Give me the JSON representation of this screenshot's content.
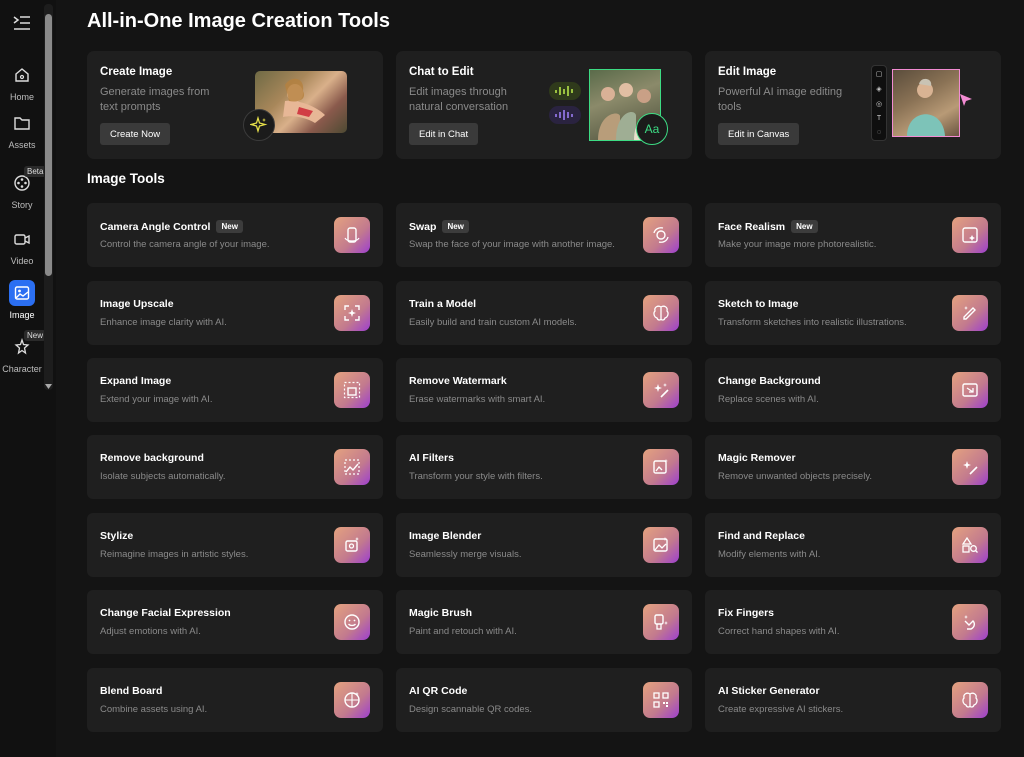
{
  "sidebar": {
    "items": [
      {
        "label": "Home"
      },
      {
        "label": "Assets"
      },
      {
        "label": "Story",
        "badge": "Beta"
      },
      {
        "label": "Video"
      },
      {
        "label": "Image"
      },
      {
        "label": "Character",
        "badge": "New"
      }
    ]
  },
  "page": {
    "title": "All-in-One Image Creation Tools",
    "section_title": "Image Tools"
  },
  "features": [
    {
      "title": "Create Image",
      "desc": "Generate images from text prompts",
      "button": "Create Now"
    },
    {
      "title": "Chat to Edit",
      "desc": "Edit images through natural conversation",
      "button": "Edit in Chat"
    },
    {
      "title": "Edit Image",
      "desc": "Powerful AI image editing tools",
      "button": "Edit in Canvas"
    }
  ],
  "feature_visual": {
    "aa_label": "Aa"
  },
  "tools": [
    {
      "title": "Camera Angle Control",
      "badge": "New",
      "desc": "Control the camera angle of your image."
    },
    {
      "title": "Swap",
      "badge": "New",
      "desc": "Swap the face of your image with another image."
    },
    {
      "title": "Face Realism",
      "badge": "New",
      "desc": "Make your image more photorealistic."
    },
    {
      "title": "Image Upscale",
      "desc": "Enhance image clarity with AI."
    },
    {
      "title": "Train a Model",
      "desc": "Easily build and train custom AI models."
    },
    {
      "title": "Sketch to Image",
      "desc": "Transform sketches into realistic illustrations."
    },
    {
      "title": "Expand Image",
      "desc": "Extend your image with AI."
    },
    {
      "title": "Remove Watermark",
      "desc": "Erase watermarks with smart AI."
    },
    {
      "title": "Change Background",
      "desc": "Replace scenes with AI."
    },
    {
      "title": "Remove background",
      "desc": "Isolate subjects automatically."
    },
    {
      "title": "AI Filters",
      "desc": "Transform your style with filters."
    },
    {
      "title": "Magic Remover",
      "desc": "Remove unwanted objects precisely."
    },
    {
      "title": "Stylize",
      "desc": "Reimagine images in artistic styles."
    },
    {
      "title": "Image Blender",
      "desc": "Seamlessly merge visuals."
    },
    {
      "title": "Find and Replace",
      "desc": "Modify elements with AI."
    },
    {
      "title": "Change Facial Expression",
      "desc": "Adjust emotions with AI."
    },
    {
      "title": "Magic Brush",
      "desc": "Paint and retouch with AI."
    },
    {
      "title": "Fix Fingers",
      "desc": "Correct hand shapes with AI."
    },
    {
      "title": "Blend Board",
      "desc": "Combine assets using AI."
    },
    {
      "title": "AI QR Code",
      "desc": "Design scannable QR codes."
    },
    {
      "title": "AI Sticker Generator",
      "desc": "Create expressive AI stickers."
    }
  ],
  "colors": {
    "background": "#141414",
    "card": "#1f1f1f",
    "accent_blue": "#2b6ff2",
    "chat_green": "#3ddc84",
    "edit_pink": "#f28bd2"
  }
}
